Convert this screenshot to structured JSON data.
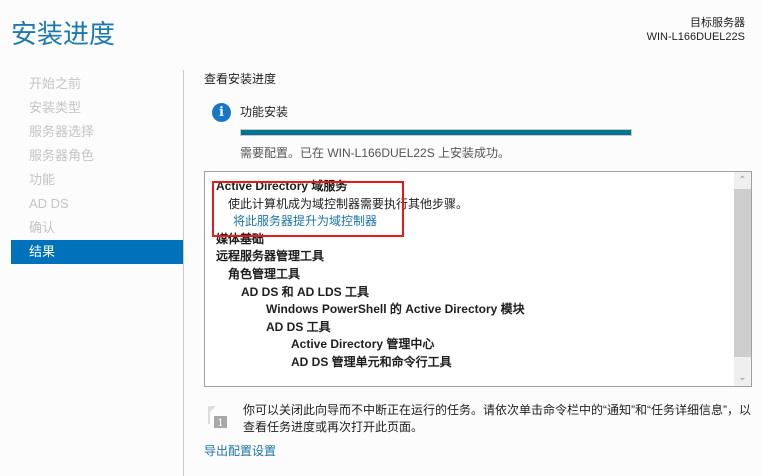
{
  "title": "安装进度",
  "target": {
    "label": "目标服务器",
    "server": "WIN-L166DUEL22S"
  },
  "nav": [
    "开始之前",
    "安装类型",
    "服务器选择",
    "服务器角色",
    "功能",
    "AD DS",
    "确认",
    "结果"
  ],
  "heading": "查看安装进度",
  "feature": {
    "label": "功能安装",
    "progress_percent": 100,
    "status": "需要配置。已在 WIN-L166DUEL22S 上安装成功。"
  },
  "results": [
    {
      "text": "Active Directory 域服务",
      "bold": true,
      "level": 0
    },
    {
      "text": "使此计算机成为域控制器需要执行其他步骤。",
      "bold": false,
      "level": 1
    },
    {
      "text": "将此服务器提升为域控制器",
      "link": true,
      "level": 1
    },
    {
      "text": "媒体基础",
      "bold": true,
      "level": 0
    },
    {
      "text": "远程服务器管理工具",
      "bold": true,
      "level": 0
    },
    {
      "text": "角色管理工具",
      "bold": true,
      "level": 1
    },
    {
      "text": "AD DS 和 AD LDS 工具",
      "bold": true,
      "level": 2
    },
    {
      "text": "Windows PowerShell 的 Active Directory 模块",
      "bold": true,
      "level": 3
    },
    {
      "text": "AD DS 工具",
      "bold": true,
      "level": 3
    },
    {
      "text": "Active Directory 管理中心",
      "bold": true,
      "level": 4
    },
    {
      "text": "AD DS 管理单元和命令行工具",
      "bold": true,
      "level": 4
    }
  ],
  "note": "你可以关闭此向导而不中断正在运行的任务。请依次单击命令栏中的“通知”和“任务详细信息”，以查看任务进度或再次打开此页面。",
  "flag_badge": "1",
  "export_link": "导出配置设置"
}
